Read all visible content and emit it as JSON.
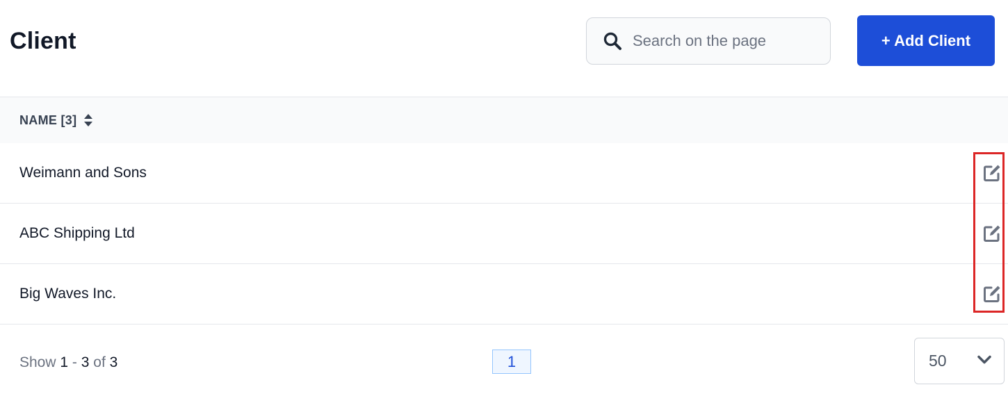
{
  "header": {
    "title": "Client",
    "search": {
      "placeholder": "Search on the page",
      "value": "",
      "icon": "search-icon"
    },
    "add_button_label": "+ Add Client"
  },
  "table": {
    "columns": [
      {
        "label": "NAME [3]",
        "sort_icon": "sort-icon"
      }
    ],
    "rows": [
      {
        "name": "Weimann and Sons",
        "action_icon": "edit-icon"
      },
      {
        "name": "ABC Shipping Ltd",
        "action_icon": "edit-icon"
      },
      {
        "name": "Big Waves Inc.",
        "action_icon": "edit-icon"
      }
    ]
  },
  "footer": {
    "show_prefix": "Show",
    "range_start": "1",
    "range_sep": "-",
    "range_end": "3",
    "of_label": "of",
    "total": "3",
    "current_page": "1",
    "per_page": "50"
  },
  "colors": {
    "primary": "#1d4ed8",
    "highlight_border": "#dc2626",
    "header_bg": "#f9fafb"
  }
}
